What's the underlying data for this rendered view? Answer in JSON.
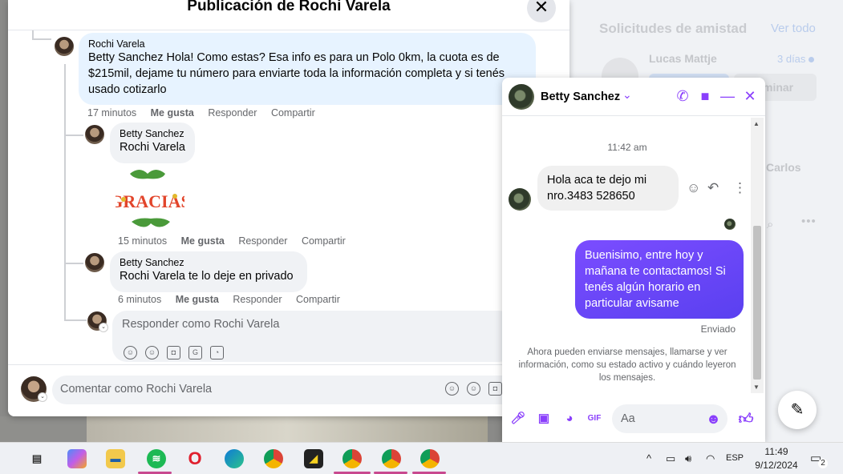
{
  "background": {
    "friend_requests_title": "Solicitudes de amistad",
    "see_all": "Ver todo",
    "request_name": "Lucas Mattje",
    "request_time": "3 días",
    "delete_label": "minar",
    "contact_name_partial": "Carlos"
  },
  "post": {
    "title": "Publicación de Rochi Varela",
    "comments": [
      {
        "author": "Rochi Varela",
        "mention": "Betty Sanchez",
        "text": " Hola! Como estas? Esa info es para un Polo 0km, la cuota es de $215mil, dejame tu número para enviarte toda la información completa y si tenés usado cotizarlo",
        "time": "17 minutos",
        "like": "Me gusta",
        "reply": "Responder",
        "share": "Compartir"
      },
      {
        "author": "Betty Sanchez",
        "mention": "Rochi Varela",
        "text": "",
        "time": "15 minutos",
        "like": "Me gusta",
        "reply": "Responder",
        "share": "Compartir",
        "sticker": "GRACIAS"
      },
      {
        "author": "Betty Sanchez",
        "mention": "Rochi Varela",
        "text": " te lo deje en privado",
        "time": "6 minutos",
        "like": "Me gusta",
        "reply": "Responder",
        "share": "Compartir"
      }
    ],
    "reply_placeholder": "Responder como Rochi Varela",
    "comment_placeholder": "Comentar como Rochi Varela"
  },
  "chat": {
    "contact": "Betty Sanchez",
    "time_label": "11:42 am",
    "incoming": "Hola aca te dejo mi nro.3483 528650",
    "outgoing": "Buenisimo, entre hoy y mañana te contactamos! Si tenés algún horario en particular avisame",
    "sent_status": "Enviado",
    "system_message": "Ahora pueden enviarse mensajes, llamarse y ver información, como su estado activo y cuándo leyeron los mensajes.",
    "input_placeholder": "Aa"
  },
  "taskbar": {
    "language": "ESP",
    "time": "11:49",
    "date": "9/12/2024",
    "notification_count": "2"
  },
  "colors": {
    "messenger_accent": "#8a3ffc",
    "outgoing_bubble": "#5a40f0",
    "highlight_bubble": "#e7f3ff"
  }
}
